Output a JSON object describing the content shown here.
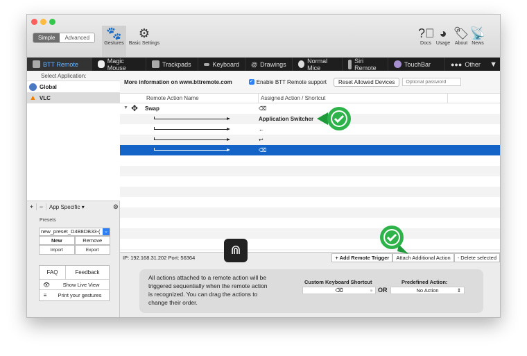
{
  "window": {
    "traffic_lights": [
      "#fc605c",
      "#fdbc40",
      "#34c84a"
    ]
  },
  "toolbar": {
    "simple": "Simple",
    "advanced": "Advanced",
    "gestures": "Gestures",
    "basic_settings": "Basic Settings",
    "docs": "Docs",
    "usage": "Usage",
    "about": "About",
    "news": "News"
  },
  "tabs": [
    {
      "label": "BTT Remote",
      "active": true
    },
    {
      "label": "Magic Mouse"
    },
    {
      "label": "Trackpads"
    },
    {
      "label": "Keyboard"
    },
    {
      "label": "Drawings"
    },
    {
      "label": "Normal Mice"
    },
    {
      "label": "Siri Remote"
    },
    {
      "label": "TouchBar"
    },
    {
      "label": "Other"
    }
  ],
  "sidebar": {
    "select_label": "Select Application:",
    "apps": [
      {
        "name": "Global"
      },
      {
        "name": "VLC",
        "selected": true
      }
    ],
    "scope": "App Specific",
    "presets_label": "Presets",
    "preset_value": "new_preset_D4B8DB33-(",
    "new": "New",
    "remove": "Remove",
    "import": "Import",
    "export": "Export",
    "faq": "FAQ",
    "feedback": "Feedback",
    "live_view": "Show Live View",
    "print": "Print your gestures"
  },
  "main": {
    "info": "More information on www.bttremote.com",
    "enable_label": "Enable BTT Remote support",
    "enable_checked": true,
    "reset": "Reset Allowed Devices",
    "password_placeholder": "Optional password",
    "columns": [
      "Remote Action Name",
      "Assigned Action / Shortcut"
    ],
    "rows": [
      {
        "name": "Swap",
        "action": "⌫"
      },
      {
        "name": "",
        "action": "Application Switcher"
      },
      {
        "name": "",
        "action": "←"
      },
      {
        "name": "",
        "action": "↩"
      },
      {
        "name": "",
        "action": "⌫",
        "selected": true
      }
    ],
    "ip": "IP:  192.168.31.202   Port: 56364",
    "add_trigger": "+ Add Remote Trigger",
    "attach": "Attach Additional Action",
    "delete": "- Delete selected",
    "help": "All actions attached to a remote action will be triggered sequentially when the remote action is recognized. You can drag the actions to change their order.",
    "shortcut_label": "Custom Keyboard Shortcut",
    "shortcut_value": "⌫",
    "or": "OR",
    "predefined_label": "Predefined Action:",
    "predefined_value": "No Action"
  },
  "colors": {
    "accent": "#1464c8",
    "check": "#2db34a"
  }
}
